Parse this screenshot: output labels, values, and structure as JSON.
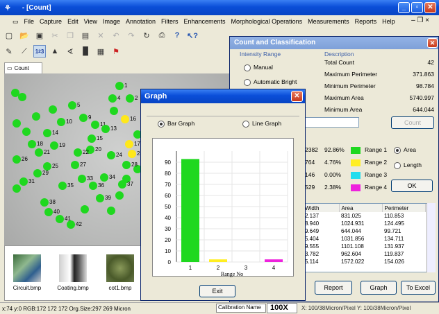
{
  "window": {
    "title": "- [Count]"
  },
  "menu": [
    "File",
    "Capture",
    "Edit",
    "View",
    "Image",
    "Annotation",
    "Filters",
    "Enhancements",
    "Morphological Operations",
    "Measurements",
    "Reports",
    "Help"
  ],
  "child_tab": "Count",
  "image_labels": [
    {
      "t": "1"
    },
    {
      "t": "2"
    },
    {
      "t": "5"
    },
    {
      "t": "10"
    },
    {
      "t": "11"
    },
    {
      "t": "13"
    },
    {
      "t": "14"
    },
    {
      "t": "15"
    },
    {
      "t": "16"
    },
    {
      "t": "17"
    },
    {
      "t": "18"
    },
    {
      "t": "19"
    },
    {
      "t": "20"
    },
    {
      "t": "21"
    },
    {
      "t": "22"
    },
    {
      "t": "23"
    },
    {
      "t": "24"
    },
    {
      "t": "25"
    },
    {
      "t": "26"
    },
    {
      "t": "27"
    },
    {
      "t": "28"
    },
    {
      "t": "29"
    },
    {
      "t": "31"
    },
    {
      "t": "33"
    },
    {
      "t": "34"
    },
    {
      "t": "35"
    },
    {
      "t": "36"
    },
    {
      "t": "37"
    },
    {
      "t": "38"
    },
    {
      "t": "39"
    },
    {
      "t": "40"
    },
    {
      "t": "41"
    },
    {
      "t": "42"
    },
    {
      "t": "4"
    },
    {
      "t": "9"
    }
  ],
  "thumbnails": [
    "Circuit.bmp",
    "Coating.bmp",
    "cot1.bmp"
  ],
  "status": {
    "coords": "x:74 y:0 RGB:172 172 172 Org.Size:297 269 Micron",
    "calibration_label": "Calibration Name",
    "calibration_value": "100X",
    "calibration_info": "X: 100/38Micron/Pixel Y: 100/38Micron/Pixel"
  },
  "count_dialog": {
    "title": "Count and Classification",
    "intensity_range_label": "Intensity Range",
    "manual_label": "Manual",
    "auto_label": "Automatic Bright",
    "description_label": "Description",
    "stats": [
      {
        "name": "Total Count",
        "value": "42"
      },
      {
        "name": "Maximum Perimeter",
        "value": "371.863"
      },
      {
        "name": "Minimum Perimeter",
        "value": "98.784"
      },
      {
        "name": "Maximum Area",
        "value": "5740.997"
      },
      {
        "name": "Minimum Area",
        "value": "644.044"
      }
    ],
    "count_button": "Count",
    "ranges": [
      {
        "count": "2382",
        "pct": "92.86%",
        "label": "Range 1",
        "color": "#1fd81f"
      },
      {
        "count": "764",
        "pct": "4.76%",
        "label": "Range 2",
        "color": "#ffee22"
      },
      {
        "count": "146",
        "pct": "0.00%",
        "label": "Range 3",
        "color": "#22ddee"
      },
      {
        "count": "529",
        "pct": "2.38%",
        "label": "Range 4",
        "color": "#ee22dd"
      }
    ],
    "area_label": "Area",
    "length_label": "Length",
    "ok_button": "OK",
    "table_headers": [
      "Width",
      "Area",
      "Perimeter"
    ],
    "table_rows": [
      [
        "2.137",
        "831.025",
        "110.853"
      ],
      [
        "8.940",
        "1024.931",
        "124.495"
      ],
      [
        "9.649",
        "644.044",
        "99.721"
      ],
      [
        "5.404",
        "1031.856",
        "134.711"
      ],
      [
        "9.555",
        "1101.108",
        "131.937"
      ],
      [
        "3.782",
        "962.604",
        "119.837"
      ],
      [
        "5.114",
        "1572.022",
        "154.026"
      ]
    ],
    "report_button": "Report",
    "graph_button": "Graph",
    "excel_button": "To Excel"
  },
  "graph_dialog": {
    "title": "Graph",
    "bar_graph_label": "Bar Graph",
    "line_graph_label": "Line Graph",
    "exit_button": "Exit"
  },
  "chart_data": {
    "type": "bar",
    "categories": [
      "1",
      "2",
      "3",
      "4"
    ],
    "values": [
      92.86,
      2.38,
      0.0,
      2.38
    ],
    "colors": [
      "#1fd81f",
      "#ffee22",
      "#22ddee",
      "#ee22dd"
    ],
    "xlabel": "Range No",
    "ylabel": "",
    "yticks": [
      0,
      10,
      20,
      30,
      40,
      50,
      60,
      70,
      80,
      90
    ],
    "ylim": [
      0,
      100
    ]
  }
}
